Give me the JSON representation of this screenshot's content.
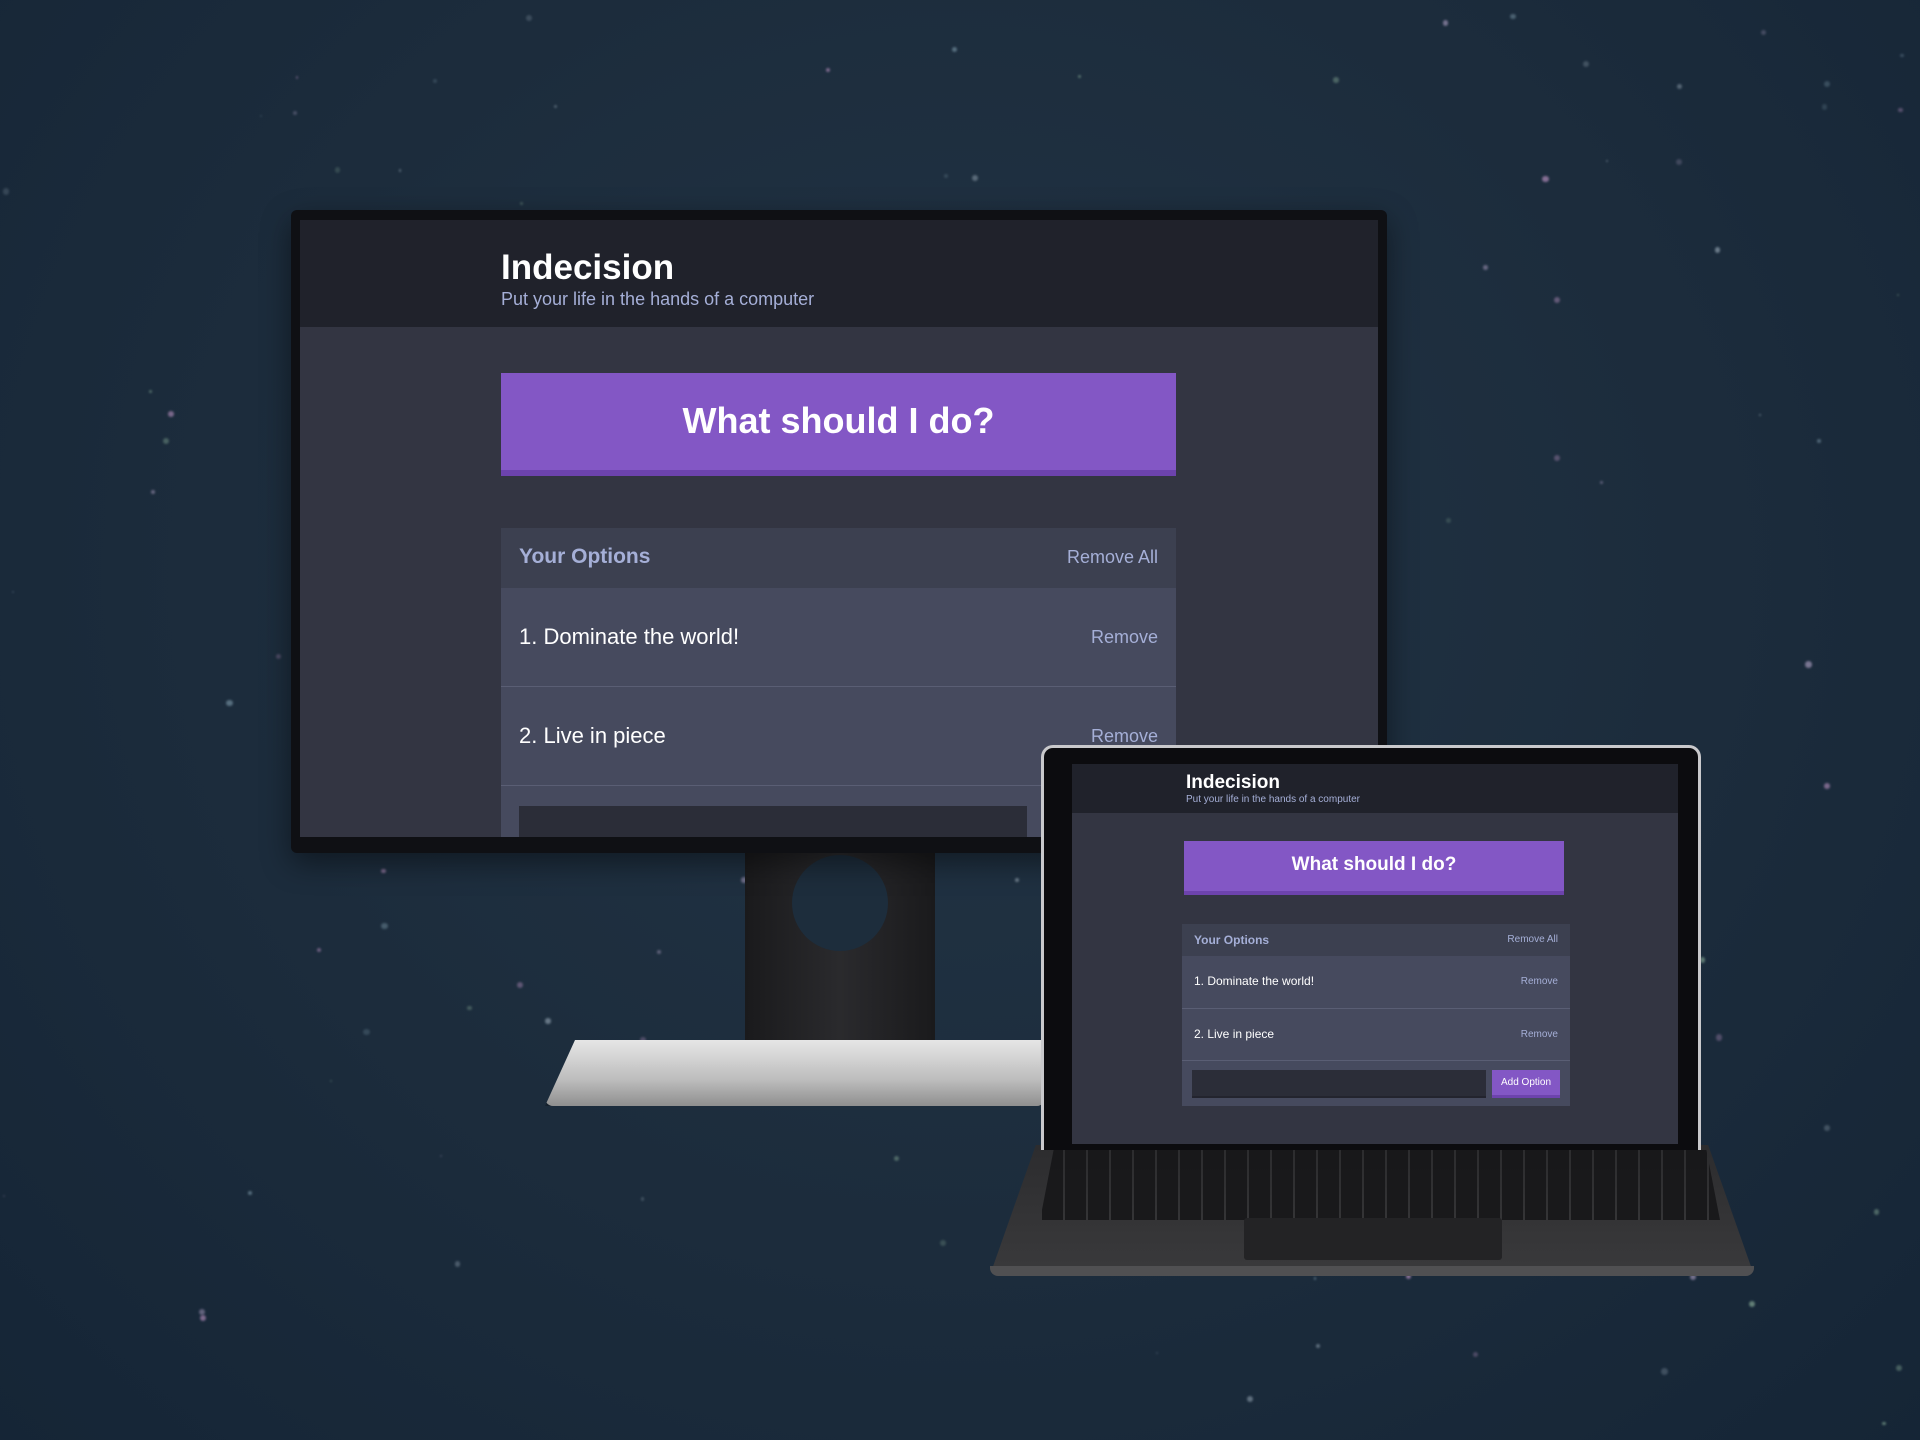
{
  "app": {
    "title": "Indecision",
    "subtitle": "Put your life in the hands of a computer",
    "action_label": "What should I do?",
    "options_title": "Your Options",
    "remove_all_label": "Remove All",
    "options": [
      {
        "text": "1. Dominate the world!",
        "remove_label": "Remove"
      },
      {
        "text": "2. Live in piece",
        "remove_label": "Remove"
      }
    ],
    "add_button_label": "Add Option"
  },
  "colors": {
    "accent": "#8357c5",
    "header_bg": "#20222b",
    "page_bg": "#333542",
    "widget_bg": "#464a5e",
    "muted_text": "#a5afd7"
  }
}
